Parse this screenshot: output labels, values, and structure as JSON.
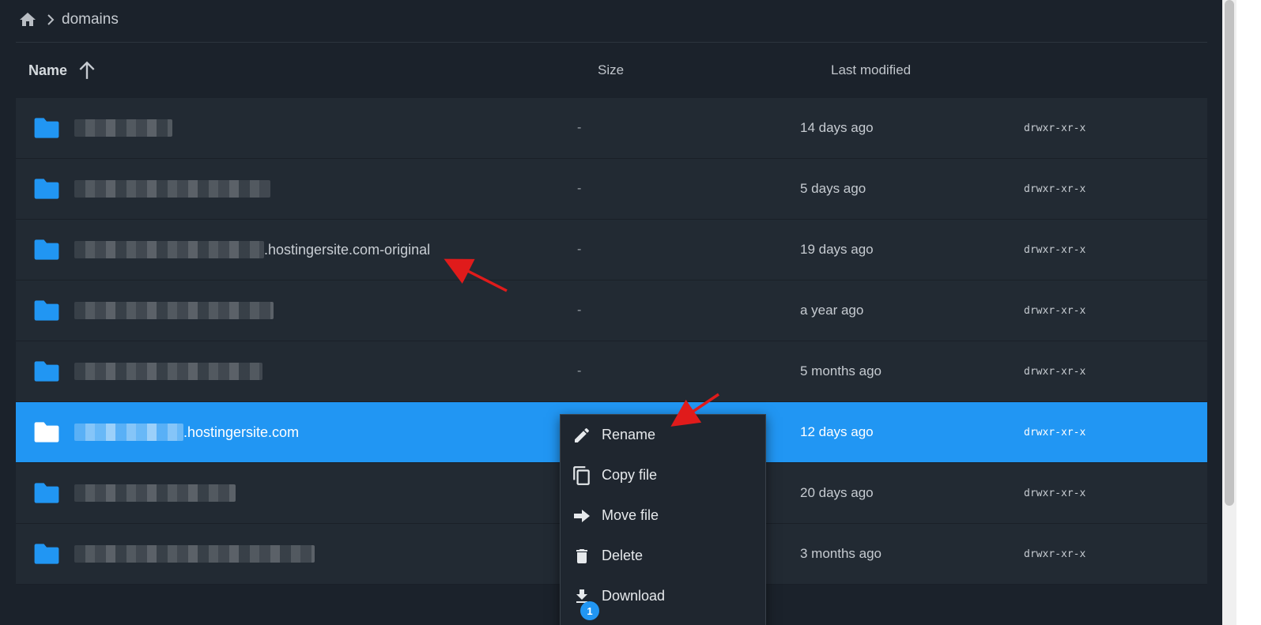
{
  "breadcrumb": {
    "items": [
      "domains"
    ]
  },
  "header": {
    "name": "Name",
    "size": "Size",
    "last_modified": "Last modified"
  },
  "rows": [
    {
      "suffix": "",
      "size": "-",
      "modified": "14 days ago",
      "perms": "drwxr-xr-x",
      "blur_width": 124,
      "selected": false
    },
    {
      "suffix": "",
      "size": "-",
      "modified": "5 days ago",
      "perms": "drwxr-xr-x",
      "blur_width": 248,
      "selected": false
    },
    {
      "suffix": ".hostingersite.com-original",
      "size": "-",
      "modified": "19 days ago",
      "perms": "drwxr-xr-x",
      "blur_width": 240,
      "selected": false
    },
    {
      "suffix": "",
      "size": "-",
      "modified": "a year ago",
      "perms": "drwxr-xr-x",
      "blur_width": 252,
      "selected": false
    },
    {
      "suffix": "",
      "size": "-",
      "modified": "5 months ago",
      "perms": "drwxr-xr-x",
      "blur_width": 238,
      "selected": false
    },
    {
      "suffix": ".hostingersite.com",
      "size": "",
      "modified": "12 days ago",
      "perms": "drwxr-xr-x",
      "blur_width": 138,
      "selected": true
    },
    {
      "suffix": "",
      "size": "",
      "modified": "20 days ago",
      "perms": "drwxr-xr-x",
      "blur_width": 204,
      "selected": false
    },
    {
      "suffix": "",
      "size": "",
      "modified": "3 months ago",
      "perms": "drwxr-xr-x",
      "blur_width": 304,
      "selected": false
    }
  ],
  "context_menu": {
    "items": [
      {
        "label": "Rename",
        "icon": "pencil-icon"
      },
      {
        "label": "Copy file",
        "icon": "copy-icon"
      },
      {
        "label": "Move file",
        "icon": "arrow-right-icon"
      },
      {
        "label": "Delete",
        "icon": "trash-icon"
      },
      {
        "label": "Download",
        "icon": "download-icon"
      }
    ],
    "download_badge": "1"
  },
  "colors": {
    "background": "#1b222b",
    "row": "#222a33",
    "selected_row": "#2196f3",
    "folder_icon": "#2196f3",
    "annotation_arrow": "#e01b1b"
  }
}
